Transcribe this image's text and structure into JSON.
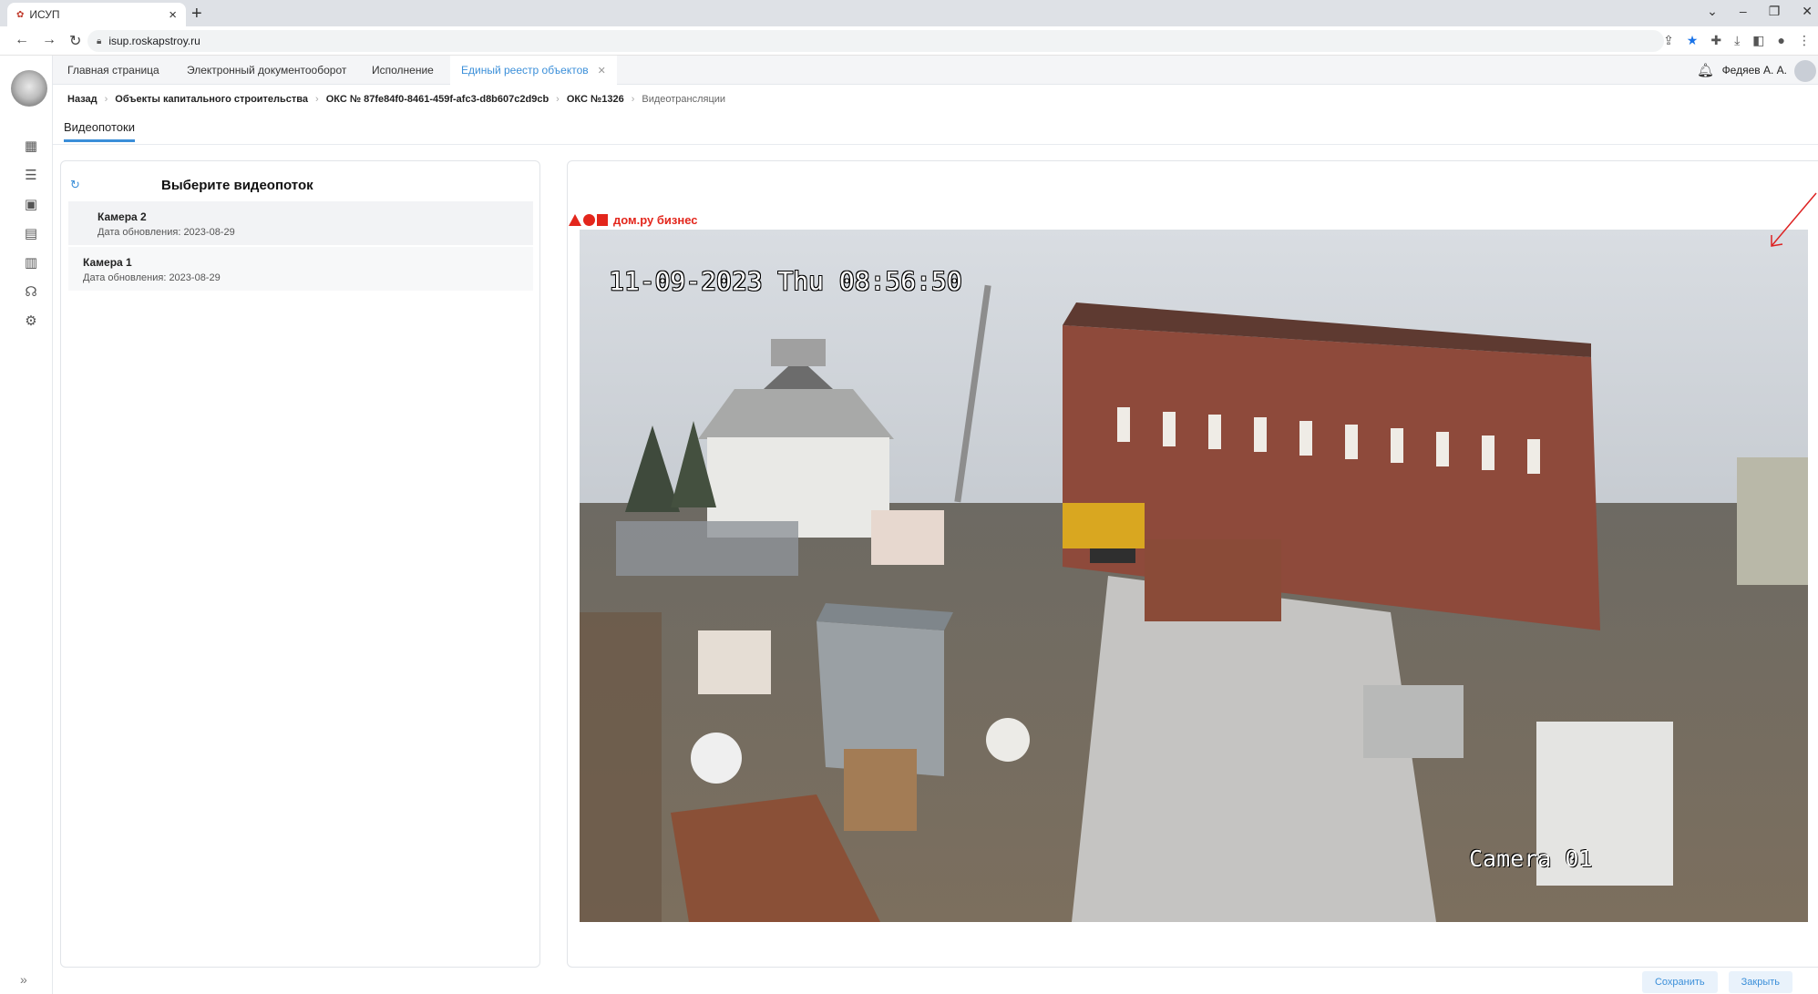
{
  "browser": {
    "tab_title": "ИСУП",
    "url": "isup.roskapstroy.ru"
  },
  "app_tabs": [
    {
      "label": "Главная страница"
    },
    {
      "label": "Электронный документооборот"
    },
    {
      "label": "Исполнение"
    },
    {
      "label": "Единый реестр объектов"
    }
  ],
  "user": {
    "name": "Федяев А. А."
  },
  "breadcrumb": [
    "Назад",
    "Объекты капитального строительства",
    "ОКС № 87fe84f0-8461-459f-afc3-d8b607c2d9cb",
    "ОКС №1326",
    "Видеотрансляции"
  ],
  "subtab": "Видеопотоки",
  "stream_panel": {
    "title": "Выберите видеопоток",
    "cameras": [
      {
        "name": "Камера 2",
        "date": "Дата обновления: 2023-08-29"
      },
      {
        "name": "Камера 1",
        "date": "Дата обновления: 2023-08-29"
      }
    ]
  },
  "video": {
    "brand": "дом.ру бизнес",
    "osd_datetime": "11-09-2023 Thu 08:56:50",
    "osd_camera": "Camera 01"
  },
  "footer": {
    "save": "Сохранить",
    "close": "Закрыть"
  },
  "colors": {
    "accent": "#3b8fd9",
    "brand_red": "#e3261c"
  }
}
